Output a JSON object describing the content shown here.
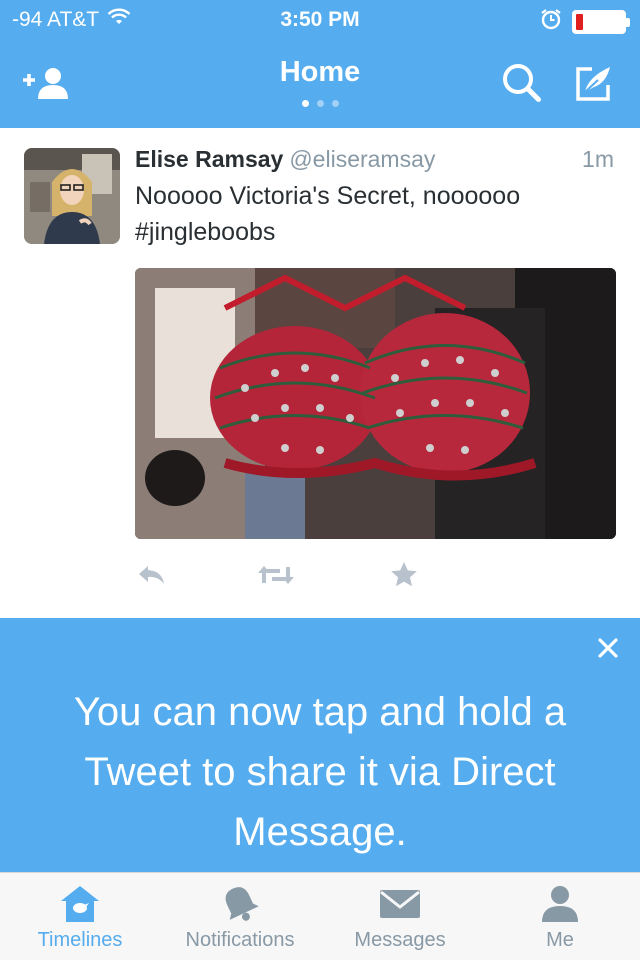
{
  "status_bar": {
    "carrier": "-94 AT&T",
    "time": "3:50 PM",
    "battery_level": 0.15,
    "battery_color": "#e0201f"
  },
  "navbar": {
    "title": "Home",
    "page_indicator": {
      "count": 3,
      "active": 0
    },
    "left_icon": "add-user-icon",
    "right_icons": [
      "search-icon",
      "compose-icon"
    ]
  },
  "tweet": {
    "name": "Elise Ramsay",
    "handle": "@eliseramsay",
    "time": "1m",
    "text": "Nooooo Victoria's Secret, noooooo #jingleboobs",
    "actions": [
      "reply-icon",
      "retweet-icon",
      "favorite-icon"
    ]
  },
  "banner": {
    "message": "You can now tap and hold a Tweet to share it via Direct Message.",
    "close_icon": "close-icon"
  },
  "tabbar": {
    "tabs": [
      {
        "label": "Timelines",
        "icon": "home-icon",
        "active": true
      },
      {
        "label": "Notifications",
        "icon": "bell-icon",
        "active": false
      },
      {
        "label": "Messages",
        "icon": "envelope-icon",
        "active": false
      },
      {
        "label": "Me",
        "icon": "person-icon",
        "active": false
      }
    ]
  },
  "colors": {
    "accent": "#55acee",
    "text": "#292f33",
    "secondary": "#8899a6",
    "icon_gray": "#b8c2cc"
  }
}
